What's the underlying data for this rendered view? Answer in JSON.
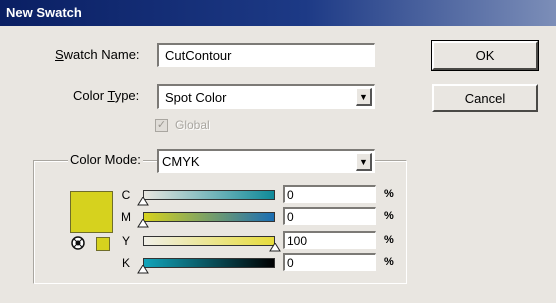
{
  "dialog": {
    "title": "New Swatch",
    "ok_label": "OK",
    "cancel_label": "Cancel"
  },
  "swatch_name": {
    "label_prefix": "S",
    "label_rest": "watch Name:",
    "value": "CutContour"
  },
  "color_type": {
    "label_prefix": "Color ",
    "label_underline": "T",
    "label_rest": "ype:",
    "value": "Spot Color"
  },
  "global": {
    "label": "Global",
    "checked": true,
    "enabled": false
  },
  "color_mode": {
    "label": "Color Mode:",
    "value": "CMYK"
  },
  "swatch_color": "#d6d21e",
  "channels": [
    {
      "label": "C",
      "value": "0",
      "unit": "%",
      "gradient_start": "#e8e6e0",
      "gradient_end": "#0f8a9a",
      "level": 0
    },
    {
      "label": "M",
      "value": "0",
      "unit": "%",
      "gradient_start": "#d6d21e",
      "gradient_end": "#1b6eb3",
      "level": 0
    },
    {
      "label": "Y",
      "value": "100",
      "unit": "%",
      "gradient_start": "#f0efe8",
      "gradient_end": "#e7dc3c",
      "level": 1
    },
    {
      "label": "K",
      "value": "0",
      "unit": "%",
      "gradient_start": "#12a4ba",
      "gradient_end": "#000000",
      "level": 0
    }
  ]
}
